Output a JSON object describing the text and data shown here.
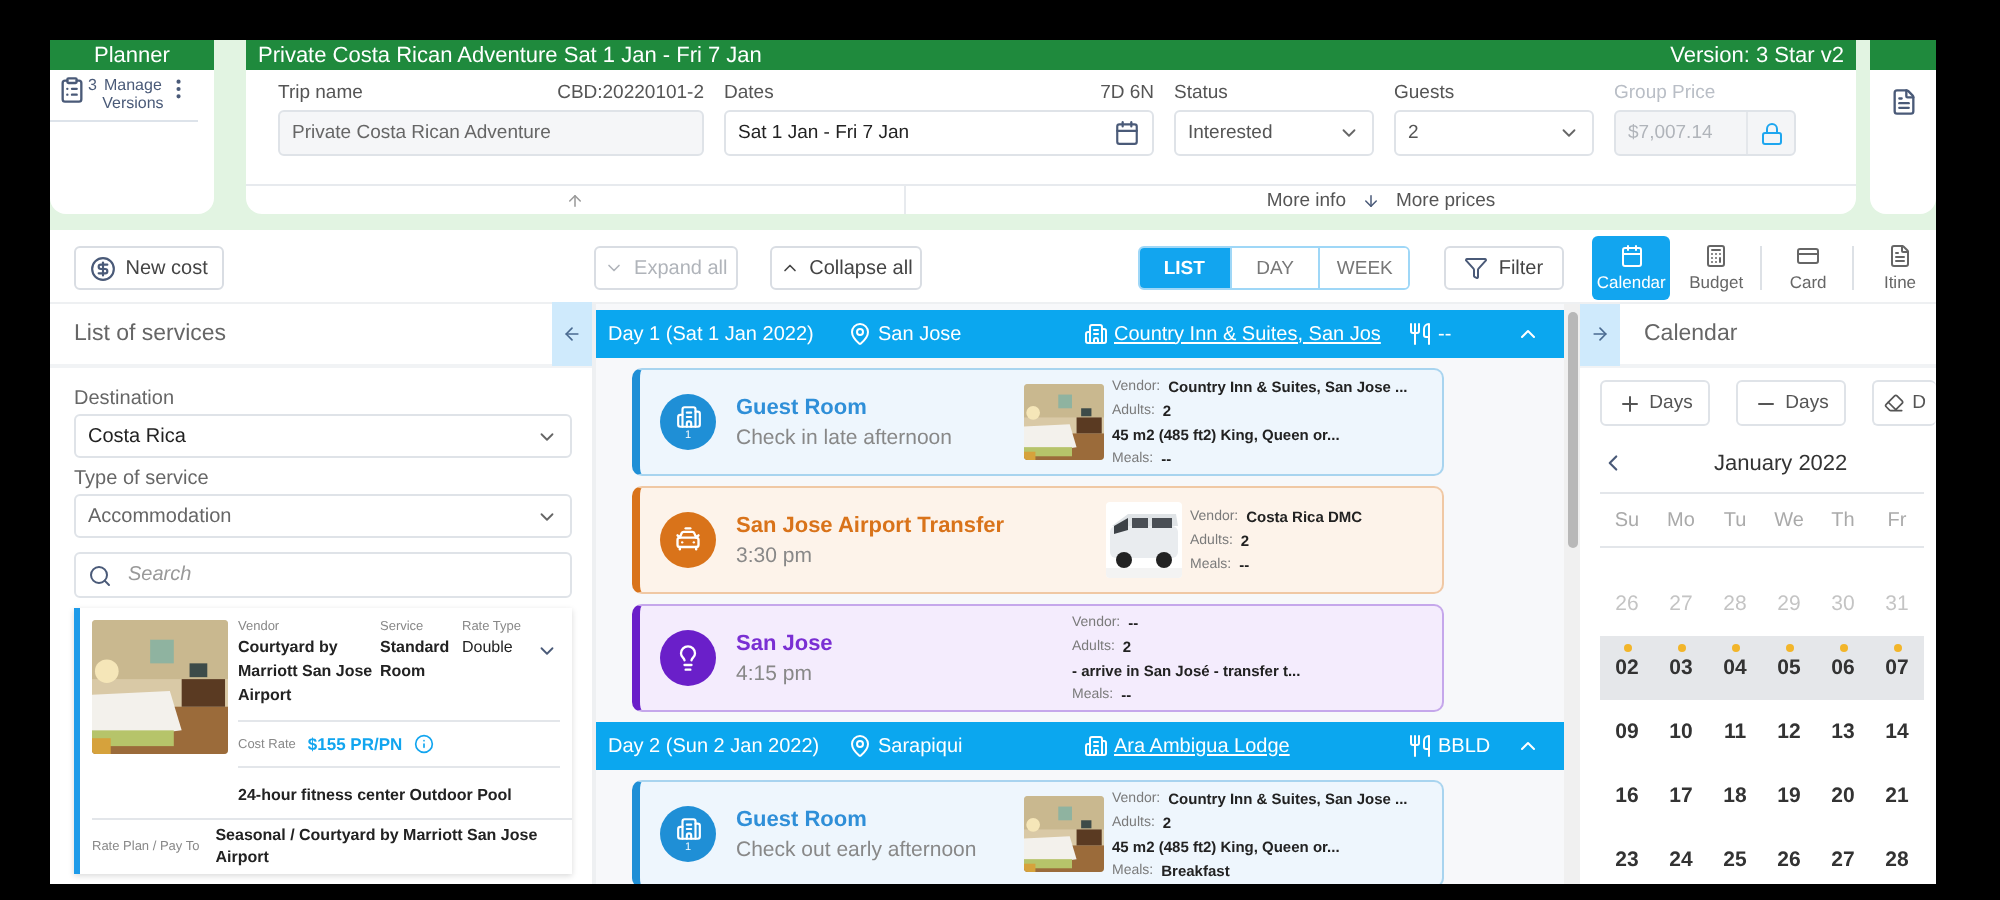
{
  "planner": {
    "title": "Planner",
    "versions_count": "3",
    "versions_label": "Manage Versions"
  },
  "trip": {
    "title": "Private Costa Rican Adventure Sat 1 Jan - Fri 7 Jan",
    "version": "Version: 3 Star v2",
    "trip_name": {
      "label": "Trip name",
      "code": "CBD:20220101-2",
      "value": "Private Costa Rican Adventure"
    },
    "dates": {
      "label": "Dates",
      "length": "7D 6N",
      "value": "Sat 1 Jan - Fri 7 Jan"
    },
    "status": {
      "label": "Status",
      "value": "Interested"
    },
    "guests": {
      "label": "Guests",
      "value": "2"
    },
    "group_price": {
      "label": "Group Price",
      "value": "$7,007.14",
      "disabled": true,
      "locked": true
    },
    "more_info": "More info",
    "more_prices": "More prices"
  },
  "toolbar": {
    "new_cost": "New cost",
    "expand_all": {
      "label": "Expand all",
      "disabled": true
    },
    "collapse_all": {
      "label": "Collapse all",
      "disabled": false
    },
    "view_tabs": [
      {
        "label": "LIST",
        "selected": true
      },
      {
        "label": "DAY",
        "selected": false
      },
      {
        "label": "WEEK",
        "selected": false
      }
    ],
    "filter": "Filter",
    "panel_tabs": [
      {
        "kind": "calendar",
        "label": "Calendar",
        "selected": true
      },
      {
        "kind": "budget",
        "label": "Budget",
        "selected": false
      },
      {
        "kind": "card",
        "label": "Card",
        "selected": false
      },
      {
        "kind": "itinerary",
        "label": "Itine",
        "selected": false
      }
    ]
  },
  "services": {
    "title": "List of services",
    "destination": {
      "label": "Destination",
      "value": "Costa Rica"
    },
    "service_type": {
      "label": "Type of service",
      "value": "Accommodation"
    },
    "search": {
      "placeholder": "Search"
    },
    "results": [
      {
        "image": {
          "kind": "picture"
        },
        "vendor_label": "Vendor",
        "vendor": "Courtyard by Marriott San Jose Airport",
        "service_label": "Service",
        "service": "Standard Room",
        "rate_type_label": "Rate Type",
        "rate_type": "Double",
        "cost_rate_label": "Cost Rate",
        "cost_rate": "$155 PR/PN",
        "amenities": "24-hour fitness center Outdoor Pool",
        "rate_plan_label": "Rate Plan / Pay To",
        "rate_plan": "Seasonal / Courtyard by Marriott San Jose Airport"
      }
    ]
  },
  "itinerary": {
    "days": [
      {
        "label": "Day 1 (Sat 1 Jan 2022)",
        "location": "San Jose",
        "hotel": "Country Inn & Suites, San Jos",
        "meals": "--",
        "expanded": true,
        "items": [
          {
            "kind": "accommodation",
            "title": "Guest Room",
            "subtitle": "Check in late afternoon",
            "badge": "1",
            "image": {
              "kind": "picture"
            },
            "details": [
              {
                "label": "Vendor:",
                "value": "Country Inn & Suites, San Jose ..."
              },
              {
                "label": "Adults:",
                "value": "2"
              },
              {
                "value": "45 m2 (485 ft2) King, Queen or..."
              },
              {
                "label": "Meals:",
                "value": "--"
              }
            ]
          },
          {
            "kind": "transfer",
            "title": "San Jose Airport Transfer",
            "subtitle": "3:30 pm",
            "image": {
              "kind": "picture"
            },
            "details": [
              {
                "label": "Vendor:",
                "value": "Costa Rica DMC"
              },
              {
                "label": "Adults:",
                "value": "2"
              },
              {
                "label": "Meals:",
                "value": "--"
              }
            ]
          },
          {
            "kind": "activity",
            "title": "San Jose",
            "subtitle": "4:15 pm",
            "details": [
              {
                "label": "Vendor:",
                "value": "--"
              },
              {
                "label": "Adults:",
                "value": "2"
              },
              {
                "value": "- arrive in San José - transfer t..."
              },
              {
                "label": "Meals:",
                "value": "--"
              }
            ]
          }
        ]
      },
      {
        "label": "Day 2 (Sun 2 Jan 2022)",
        "location": "Sarapiqui",
        "hotel": "Ara Ambigua Lodge",
        "meals": "BBLD",
        "expanded": true,
        "items": [
          {
            "kind": "accommodation",
            "title": "Guest Room",
            "subtitle": "Check out early afternoon",
            "badge": "1",
            "image": {
              "kind": "picture"
            },
            "details": [
              {
                "label": "Vendor:",
                "value": "Country Inn & Suites, San Jose ..."
              },
              {
                "label": "Adults:",
                "value": "2"
              },
              {
                "value": "45 m2 (485 ft2) King, Queen or..."
              },
              {
                "label": "Meals:",
                "value": "Breakfast"
              }
            ]
          }
        ]
      }
    ]
  },
  "calendar": {
    "title": "Calendar",
    "buttons": [
      {
        "kind": "add",
        "label": "Days"
      },
      {
        "kind": "remove",
        "label": "Days"
      },
      {
        "kind": "clear",
        "label": "D"
      }
    ],
    "month": "January 2022",
    "weekdays": [
      "Su",
      "Mo",
      "Tu",
      "We",
      "Th",
      "Fr"
    ],
    "weeks": [
      [
        {
          "day": "26",
          "outside": true,
          "selected": false,
          "event": false
        },
        {
          "day": "27",
          "outside": true,
          "selected": false,
          "event": false
        },
        {
          "day": "28",
          "outside": true,
          "selected": false,
          "event": false
        },
        {
          "day": "29",
          "outside": true,
          "selected": false,
          "event": false
        },
        {
          "day": "30",
          "outside": true,
          "selected": false,
          "event": false
        },
        {
          "day": "31",
          "outside": true,
          "selected": false,
          "event": false
        }
      ],
      [
        {
          "day": "02",
          "outside": false,
          "selected": true,
          "event": true
        },
        {
          "day": "03",
          "outside": false,
          "selected": true,
          "event": true
        },
        {
          "day": "04",
          "outside": false,
          "selected": true,
          "event": true
        },
        {
          "day": "05",
          "outside": false,
          "selected": true,
          "event": true
        },
        {
          "day": "06",
          "outside": false,
          "selected": true,
          "event": true
        },
        {
          "day": "07",
          "outside": false,
          "selected": true,
          "event": true
        }
      ],
      [
        {
          "day": "09",
          "outside": false,
          "selected": false,
          "event": false
        },
        {
          "day": "10",
          "outside": false,
          "selected": false,
          "event": false
        },
        {
          "day": "11",
          "outside": false,
          "selected": false,
          "event": false
        },
        {
          "day": "12",
          "outside": false,
          "selected": false,
          "event": false
        },
        {
          "day": "13",
          "outside": false,
          "selected": false,
          "event": false
        },
        {
          "day": "14",
          "outside": false,
          "selected": false,
          "event": false
        }
      ],
      [
        {
          "day": "16",
          "outside": false,
          "selected": false,
          "event": false
        },
        {
          "day": "17",
          "outside": false,
          "selected": false,
          "event": false
        },
        {
          "day": "18",
          "outside": false,
          "selected": false,
          "event": false
        },
        {
          "day": "19",
          "outside": false,
          "selected": false,
          "event": false
        },
        {
          "day": "20",
          "outside": false,
          "selected": false,
          "event": false
        },
        {
          "day": "21",
          "outside": false,
          "selected": false,
          "event": false
        }
      ],
      [
        {
          "day": "23",
          "outside": false,
          "selected": false,
          "event": false
        },
        {
          "day": "24",
          "outside": false,
          "selected": false,
          "event": false
        },
        {
          "day": "25",
          "outside": false,
          "selected": false,
          "event": false
        },
        {
          "day": "26",
          "outside": false,
          "selected": false,
          "event": false
        },
        {
          "day": "27",
          "outside": false,
          "selected": false,
          "event": false
        },
        {
          "day": "28",
          "outside": false,
          "selected": false,
          "event": false
        }
      ]
    ]
  }
}
